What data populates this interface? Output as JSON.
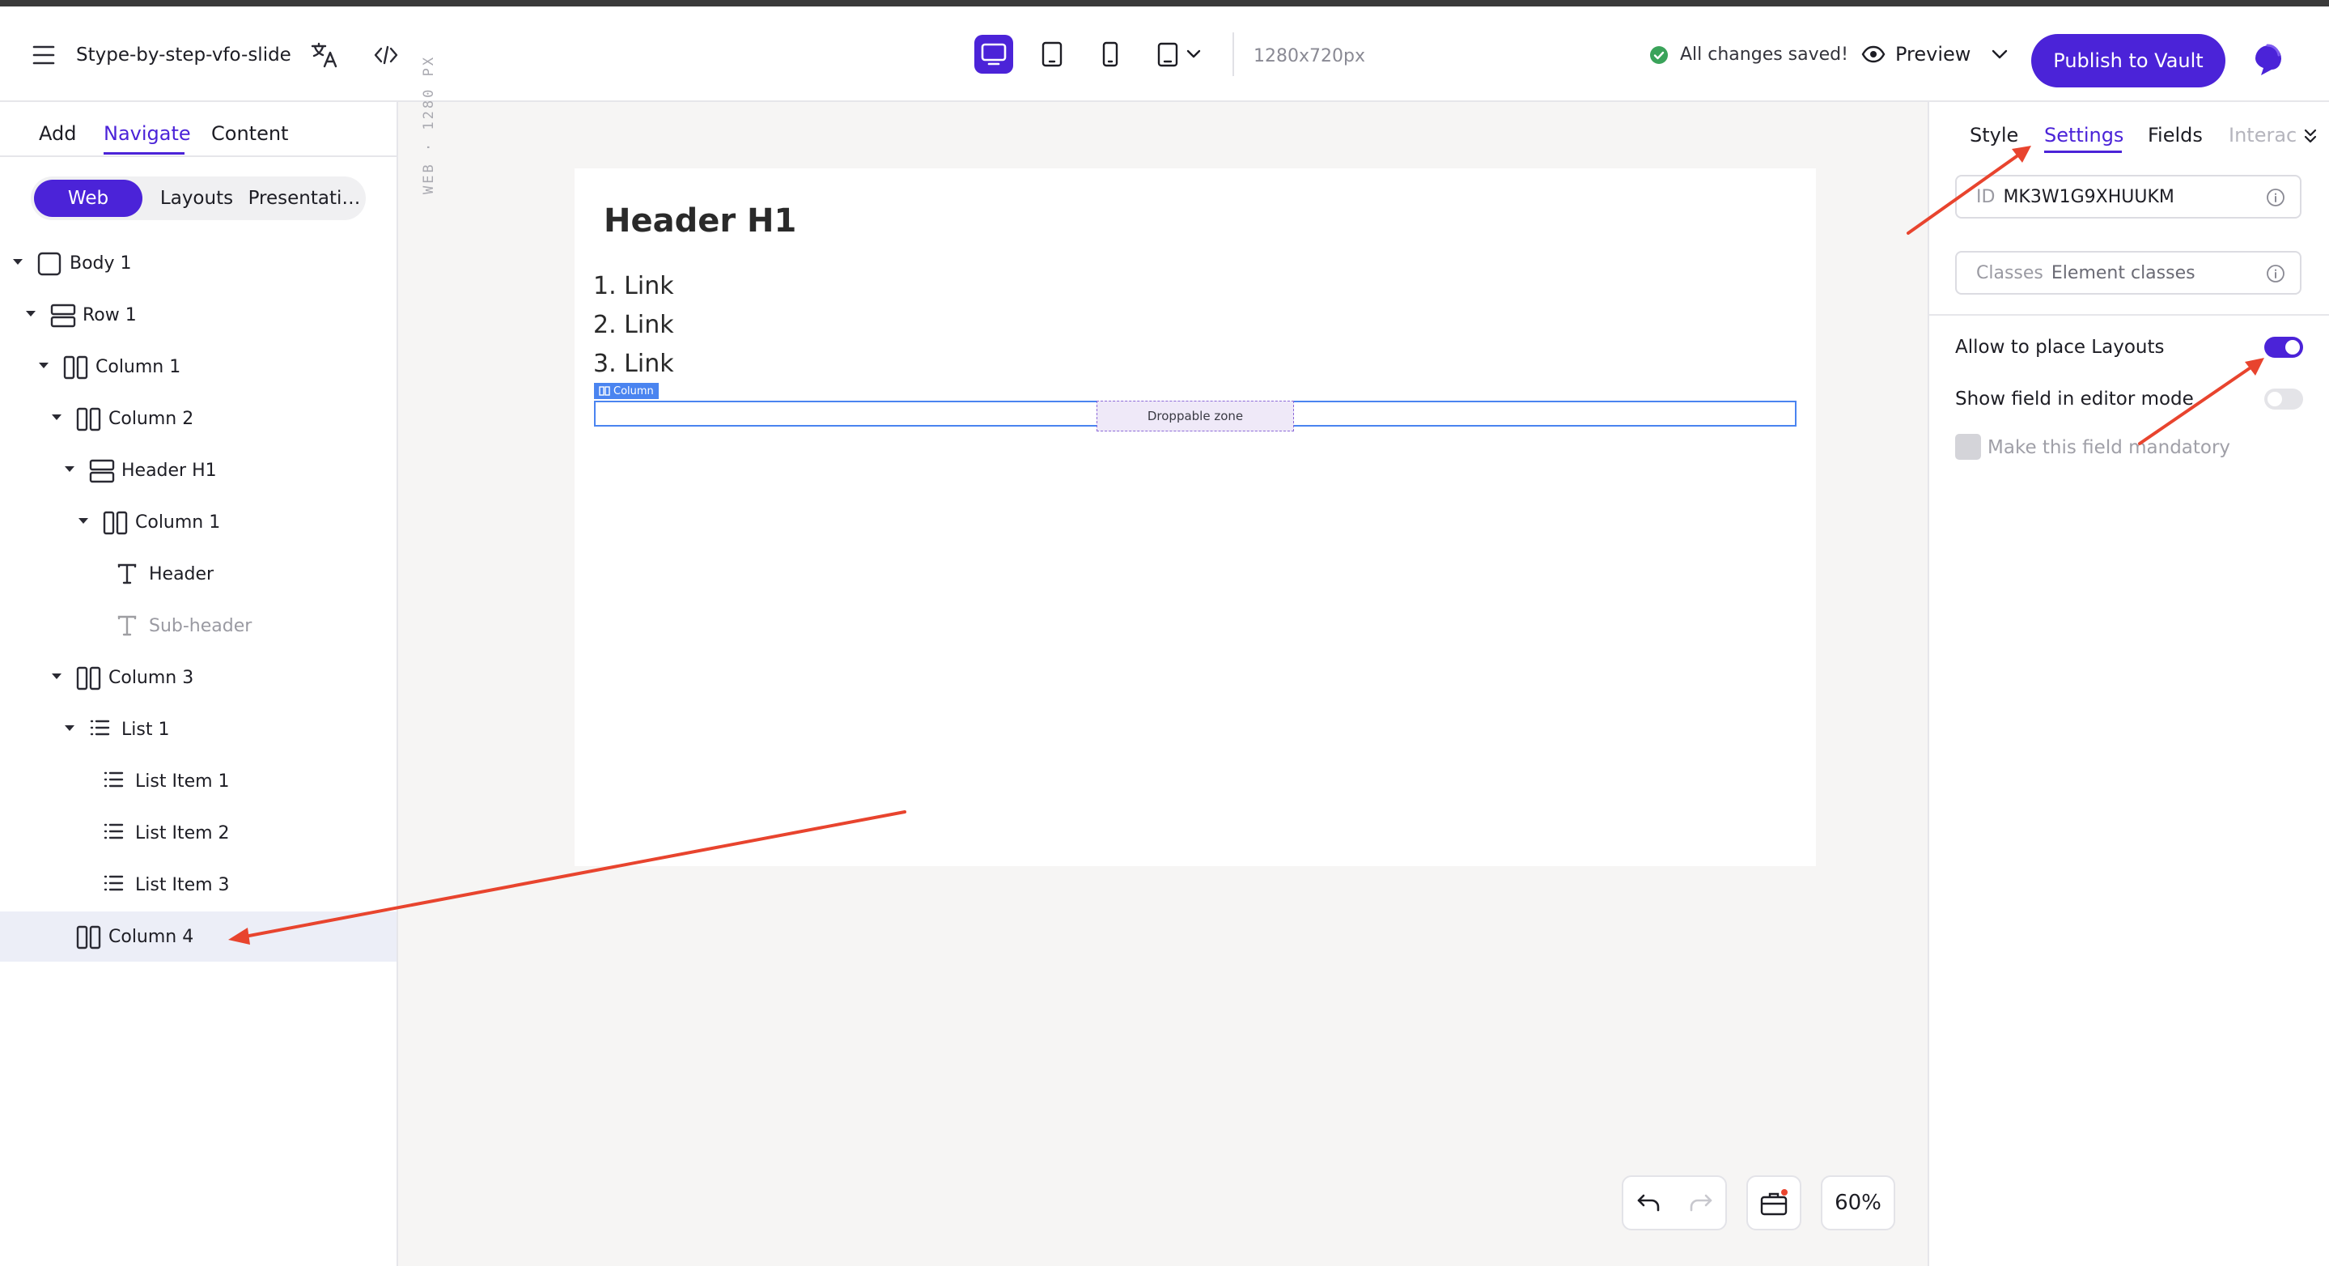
{
  "header": {
    "doc_name": "Stype-by-step-vfo-slide",
    "resolution": "1280x720px",
    "saved_status": "All changes saved!",
    "preview_label": "Preview",
    "publish_label": "Publish to Vault",
    "icons": [
      "hamburger-menu-icon",
      "translate-icon",
      "code-icon",
      "desktop-icon",
      "tablet-icon",
      "mobile-icon",
      "device-dropdown-icon",
      "check-circle-icon",
      "eye-icon",
      "chevron-down-icon",
      "avatar-icon"
    ]
  },
  "left_panel": {
    "tabs": [
      "Add",
      "Navigate",
      "Content"
    ],
    "active_tab": "Navigate",
    "segments": [
      "Web",
      "Layouts",
      "Presentati…"
    ],
    "active_segment": "Web",
    "tree": [
      {
        "label": "Body 1",
        "icon": "frame-icon",
        "depth": 0,
        "expanded": true
      },
      {
        "label": "Row 1",
        "icon": "row-icon",
        "depth": 1,
        "expanded": true
      },
      {
        "label": "Column 1",
        "icon": "column-icon",
        "depth": 2,
        "expanded": true
      },
      {
        "label": "Column 2",
        "icon": "column-icon",
        "depth": 3,
        "expanded": true
      },
      {
        "label": "Header H1",
        "icon": "row-icon",
        "depth": 4,
        "expanded": true
      },
      {
        "label": "Column 1",
        "icon": "column-icon",
        "depth": 5,
        "expanded": true
      },
      {
        "label": "Header",
        "icon": "text-icon",
        "depth": 6
      },
      {
        "label": "Sub-header",
        "icon": "text-icon",
        "depth": 6,
        "muted": true
      },
      {
        "label": "Column 3",
        "icon": "column-icon",
        "depth": 3,
        "expanded": true
      },
      {
        "label": "List 1",
        "icon": "list-icon",
        "depth": 4,
        "expanded": true
      },
      {
        "label": "List Item 1",
        "icon": "list-icon",
        "depth": 5
      },
      {
        "label": "List Item 2",
        "icon": "list-icon",
        "depth": 5
      },
      {
        "label": "List Item 3",
        "icon": "list-icon",
        "depth": 5
      },
      {
        "label": "Column 4",
        "icon": "column-icon",
        "depth": 3,
        "selected": true
      }
    ]
  },
  "canvas": {
    "ruler_label": "WEB · 1280 PX",
    "header_text": "Header H1",
    "links": [
      "1. Link",
      "2. Link",
      "3. Link"
    ],
    "column_tag": "Column",
    "droppable_label": "Droppable zone"
  },
  "tools": {
    "zoom": "60%",
    "icons": [
      "undo-icon",
      "redo-icon",
      "briefcase-icon"
    ]
  },
  "right_panel": {
    "tabs": [
      "Style",
      "Settings",
      "Fields",
      "Interac"
    ],
    "active_tab": "Settings",
    "id_label": "ID",
    "id_value": "MK3W1G9XHUUKM",
    "classes_label": "Classes",
    "classes_placeholder": "Element classes",
    "allow_layouts_label": "Allow to place Layouts",
    "allow_layouts_on": true,
    "show_field_label": "Show field in editor mode",
    "show_field_on": false,
    "mandatory_label": "Make this field mandatory",
    "mandatory_checked": false
  },
  "colors": {
    "accent": "#4b23d8",
    "selection": "#4a84f0",
    "annotation": "#e8442e",
    "success": "#3aa35a"
  }
}
